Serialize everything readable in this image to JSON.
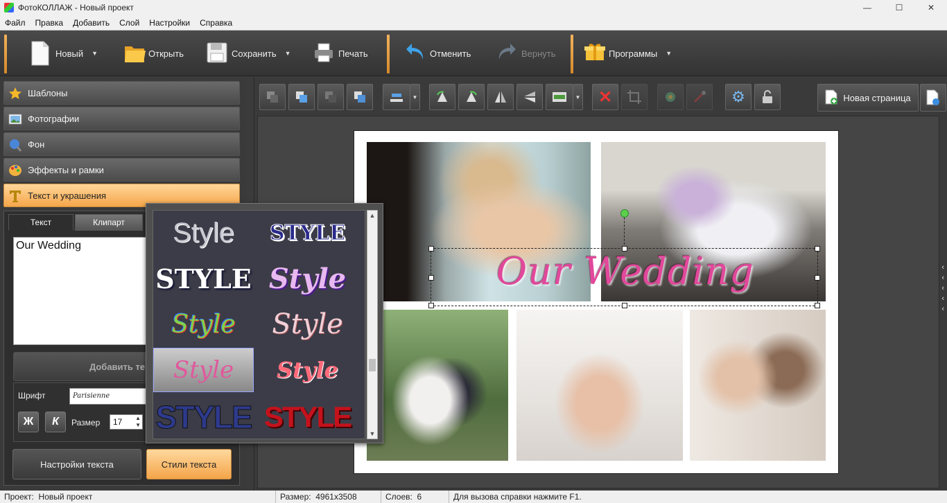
{
  "window": {
    "title": "ФотоКОЛЛАЖ - Новый проект",
    "controls": [
      "—",
      "☐",
      "✕"
    ]
  },
  "menu": [
    "Файл",
    "Правка",
    "Добавить",
    "Слой",
    "Настройки",
    "Справка"
  ],
  "toolbar": {
    "new": "Новый",
    "open": "Открыть",
    "save": "Сохранить",
    "print": "Печать",
    "undo": "Отменить",
    "redo": "Вернуть",
    "programs": "Программы"
  },
  "left_panel": {
    "sections": [
      "Шаблоны",
      "Фотографии",
      "Фон",
      "Эффекты и рамки",
      "Текст и украшения"
    ],
    "tabs": [
      "Текст",
      "Клипарт"
    ],
    "text_value": "Our Wedding",
    "add_button": "Добавить текст",
    "font_label": "Шрифт",
    "font_value": "Parisienne",
    "bold_label": "Ж",
    "italic_label": "К",
    "size_label": "Размер",
    "size_value": "17",
    "text_settings_button": "Настройки текста",
    "text_styles_button": "Стили текста"
  },
  "style_presets": [
    {
      "label": "Style",
      "color": "#c9c9d2"
    },
    {
      "label": "STYLE",
      "color": "#2a2a8c"
    },
    {
      "label": "STYLE",
      "color": "#ffffff"
    },
    {
      "label": "Style",
      "color": "#e8b8f0"
    },
    {
      "label": "Style",
      "color": "#7fd34a"
    },
    {
      "label": "Style",
      "color": "#f0d0d8"
    },
    {
      "label": "Style",
      "color": "#e0589c"
    },
    {
      "label": "Style",
      "color": "#ff6a7a"
    },
    {
      "label": "STYLE",
      "color": "#2d3a8c"
    },
    {
      "label": "STYLE",
      "color": "#c4121c"
    }
  ],
  "workarea": {
    "new_page_button": "Новая страница"
  },
  "canvas": {
    "overlay_text": "Our Wedding"
  },
  "status": {
    "project_label": "Проект:",
    "project_value": "Новый проект",
    "size_label": "Размер:",
    "size_value": "4961x3508",
    "layers_label": "Слоев:",
    "layers_value": "6",
    "hint": "Для вызова справки нажмите F1."
  }
}
